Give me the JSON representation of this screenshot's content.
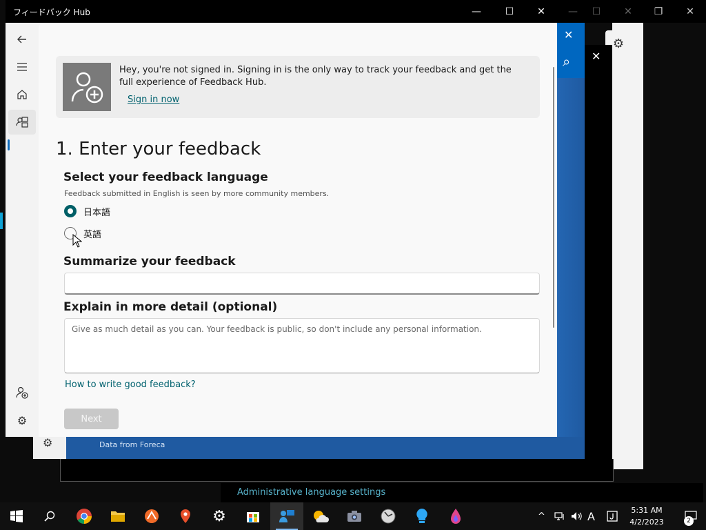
{
  "window": {
    "title": "フィードバック Hub",
    "minimize": "—",
    "maximize": "☐",
    "close": "✕"
  },
  "background": {
    "weather_footer": "Data from Foreca",
    "admin_link": "Administrative language settings"
  },
  "nav": {
    "items": [
      "back-icon",
      "menu-icon",
      "home-icon",
      "feedback-icon",
      "add-account-icon",
      "settings-icon"
    ]
  },
  "banner": {
    "text": "Hey, you're not signed in. Signing in is the only way to track your feedback and get the full experience of Feedback Hub.",
    "link": "Sign in now"
  },
  "form": {
    "heading": "1. Enter your feedback",
    "language_title": "Select your feedback language",
    "language_note": "Feedback submitted in English is seen by more community members.",
    "options": [
      {
        "label": "日本語",
        "selected": true
      },
      {
        "label": "英語",
        "selected": false
      }
    ],
    "summary_title": "Summarize your feedback",
    "summary_value": "",
    "detail_title": "Explain in more detail (optional)",
    "detail_placeholder": "Give as much detail as you can. Your feedback is public, so don't include any personal information.",
    "help_link": "How to write good feedback?",
    "next_label": "Next"
  },
  "taskbar": {
    "time": "5:31 AM",
    "date": "4/2/2023",
    "notification_count": "2",
    "ime": "A"
  },
  "colors": {
    "accent_teal": "#005f67",
    "link_teal": "#00616e",
    "weather_blue": "#1f5aa1"
  }
}
